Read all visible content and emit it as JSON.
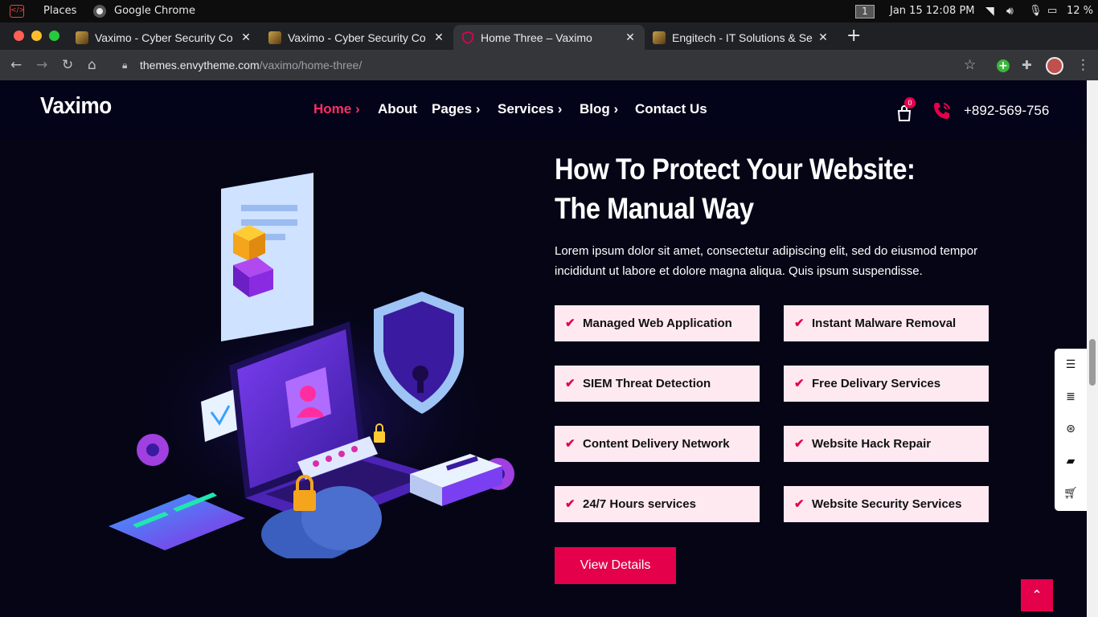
{
  "os_bar": {
    "places": "Places",
    "app": "Google Chrome",
    "workspace": "1",
    "datetime": "Jan 15  12:08 PM",
    "battery": "12 %"
  },
  "tabs": [
    {
      "title": "Vaximo - Cyber Security Co",
      "close": "✕"
    },
    {
      "title": "Vaximo - Cyber Security Co",
      "close": "✕"
    },
    {
      "title": "Home Three – Vaximo",
      "close": "✕"
    },
    {
      "title": "Engitech - IT Solutions & Se",
      "close": "✕"
    }
  ],
  "new_tab": "+",
  "address": {
    "domain": "themes.envytheme.com",
    "path": "/vaximo/home-three/"
  },
  "site": {
    "logo": "Vaximo",
    "menu": [
      {
        "label": "Home",
        "arrow": "›"
      },
      {
        "label": "About",
        "arrow": ""
      },
      {
        "label": "Pages",
        "arrow": "›"
      },
      {
        "label": "Services",
        "arrow": "›"
      },
      {
        "label": "Blog",
        "arrow": "›"
      },
      {
        "label": "Contact Us",
        "arrow": ""
      }
    ],
    "cart_count": "0",
    "phone": "+892-569-756",
    "heading": "How To Protect Your Website: The Manual Way",
    "paragraph": "Lorem ipsum dolor sit amet, consectetur adipiscing elit, sed do eiusmod tempor incididunt ut labore et dolore magna aliqua. Quis ipsum suspendisse.",
    "features": [
      "Managed Web Application",
      "Instant Malware Removal",
      "SIEM Threat Detection",
      "Free Delivary Services",
      "Content Delivery Network",
      "Website Hack Repair",
      "24/7 Hours services",
      "Website Security Services"
    ],
    "button": "View Details"
  },
  "colors": {
    "accent": "#e4004b",
    "nav_bg": "#03031a",
    "page_bg": "#050516",
    "feature_bg": "#ffe9f1"
  }
}
